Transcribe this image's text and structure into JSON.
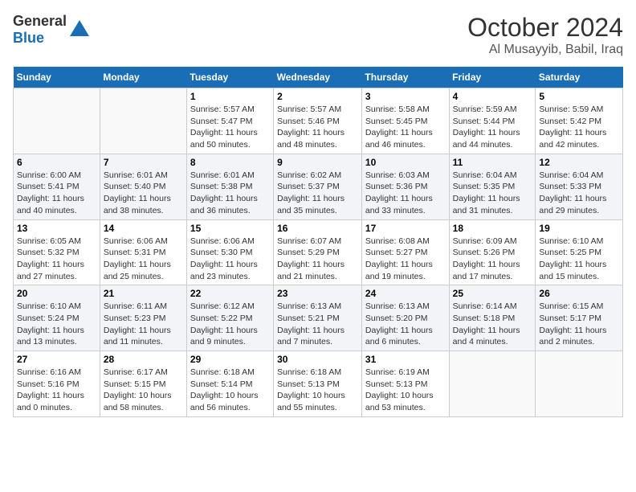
{
  "header": {
    "logo_general": "General",
    "logo_blue": "Blue",
    "month_year": "October 2024",
    "location": "Al Musayyib, Babil, Iraq"
  },
  "weekdays": [
    "Sunday",
    "Monday",
    "Tuesday",
    "Wednesday",
    "Thursday",
    "Friday",
    "Saturday"
  ],
  "weeks": [
    [
      {
        "day": "",
        "detail": ""
      },
      {
        "day": "",
        "detail": ""
      },
      {
        "day": "1",
        "detail": "Sunrise: 5:57 AM\nSunset: 5:47 PM\nDaylight: 11 hours and 50 minutes."
      },
      {
        "day": "2",
        "detail": "Sunrise: 5:57 AM\nSunset: 5:46 PM\nDaylight: 11 hours and 48 minutes."
      },
      {
        "day": "3",
        "detail": "Sunrise: 5:58 AM\nSunset: 5:45 PM\nDaylight: 11 hours and 46 minutes."
      },
      {
        "day": "4",
        "detail": "Sunrise: 5:59 AM\nSunset: 5:44 PM\nDaylight: 11 hours and 44 minutes."
      },
      {
        "day": "5",
        "detail": "Sunrise: 5:59 AM\nSunset: 5:42 PM\nDaylight: 11 hours and 42 minutes."
      }
    ],
    [
      {
        "day": "6",
        "detail": "Sunrise: 6:00 AM\nSunset: 5:41 PM\nDaylight: 11 hours and 40 minutes."
      },
      {
        "day": "7",
        "detail": "Sunrise: 6:01 AM\nSunset: 5:40 PM\nDaylight: 11 hours and 38 minutes."
      },
      {
        "day": "8",
        "detail": "Sunrise: 6:01 AM\nSunset: 5:38 PM\nDaylight: 11 hours and 36 minutes."
      },
      {
        "day": "9",
        "detail": "Sunrise: 6:02 AM\nSunset: 5:37 PM\nDaylight: 11 hours and 35 minutes."
      },
      {
        "day": "10",
        "detail": "Sunrise: 6:03 AM\nSunset: 5:36 PM\nDaylight: 11 hours and 33 minutes."
      },
      {
        "day": "11",
        "detail": "Sunrise: 6:04 AM\nSunset: 5:35 PM\nDaylight: 11 hours and 31 minutes."
      },
      {
        "day": "12",
        "detail": "Sunrise: 6:04 AM\nSunset: 5:33 PM\nDaylight: 11 hours and 29 minutes."
      }
    ],
    [
      {
        "day": "13",
        "detail": "Sunrise: 6:05 AM\nSunset: 5:32 PM\nDaylight: 11 hours and 27 minutes."
      },
      {
        "day": "14",
        "detail": "Sunrise: 6:06 AM\nSunset: 5:31 PM\nDaylight: 11 hours and 25 minutes."
      },
      {
        "day": "15",
        "detail": "Sunrise: 6:06 AM\nSunset: 5:30 PM\nDaylight: 11 hours and 23 minutes."
      },
      {
        "day": "16",
        "detail": "Sunrise: 6:07 AM\nSunset: 5:29 PM\nDaylight: 11 hours and 21 minutes."
      },
      {
        "day": "17",
        "detail": "Sunrise: 6:08 AM\nSunset: 5:27 PM\nDaylight: 11 hours and 19 minutes."
      },
      {
        "day": "18",
        "detail": "Sunrise: 6:09 AM\nSunset: 5:26 PM\nDaylight: 11 hours and 17 minutes."
      },
      {
        "day": "19",
        "detail": "Sunrise: 6:10 AM\nSunset: 5:25 PM\nDaylight: 11 hours and 15 minutes."
      }
    ],
    [
      {
        "day": "20",
        "detail": "Sunrise: 6:10 AM\nSunset: 5:24 PM\nDaylight: 11 hours and 13 minutes."
      },
      {
        "day": "21",
        "detail": "Sunrise: 6:11 AM\nSunset: 5:23 PM\nDaylight: 11 hours and 11 minutes."
      },
      {
        "day": "22",
        "detail": "Sunrise: 6:12 AM\nSunset: 5:22 PM\nDaylight: 11 hours and 9 minutes."
      },
      {
        "day": "23",
        "detail": "Sunrise: 6:13 AM\nSunset: 5:21 PM\nDaylight: 11 hours and 7 minutes."
      },
      {
        "day": "24",
        "detail": "Sunrise: 6:13 AM\nSunset: 5:20 PM\nDaylight: 11 hours and 6 minutes."
      },
      {
        "day": "25",
        "detail": "Sunrise: 6:14 AM\nSunset: 5:18 PM\nDaylight: 11 hours and 4 minutes."
      },
      {
        "day": "26",
        "detail": "Sunrise: 6:15 AM\nSunset: 5:17 PM\nDaylight: 11 hours and 2 minutes."
      }
    ],
    [
      {
        "day": "27",
        "detail": "Sunrise: 6:16 AM\nSunset: 5:16 PM\nDaylight: 11 hours and 0 minutes."
      },
      {
        "day": "28",
        "detail": "Sunrise: 6:17 AM\nSunset: 5:15 PM\nDaylight: 10 hours and 58 minutes."
      },
      {
        "day": "29",
        "detail": "Sunrise: 6:18 AM\nSunset: 5:14 PM\nDaylight: 10 hours and 56 minutes."
      },
      {
        "day": "30",
        "detail": "Sunrise: 6:18 AM\nSunset: 5:13 PM\nDaylight: 10 hours and 55 minutes."
      },
      {
        "day": "31",
        "detail": "Sunrise: 6:19 AM\nSunset: 5:13 PM\nDaylight: 10 hours and 53 minutes."
      },
      {
        "day": "",
        "detail": ""
      },
      {
        "day": "",
        "detail": ""
      }
    ]
  ]
}
